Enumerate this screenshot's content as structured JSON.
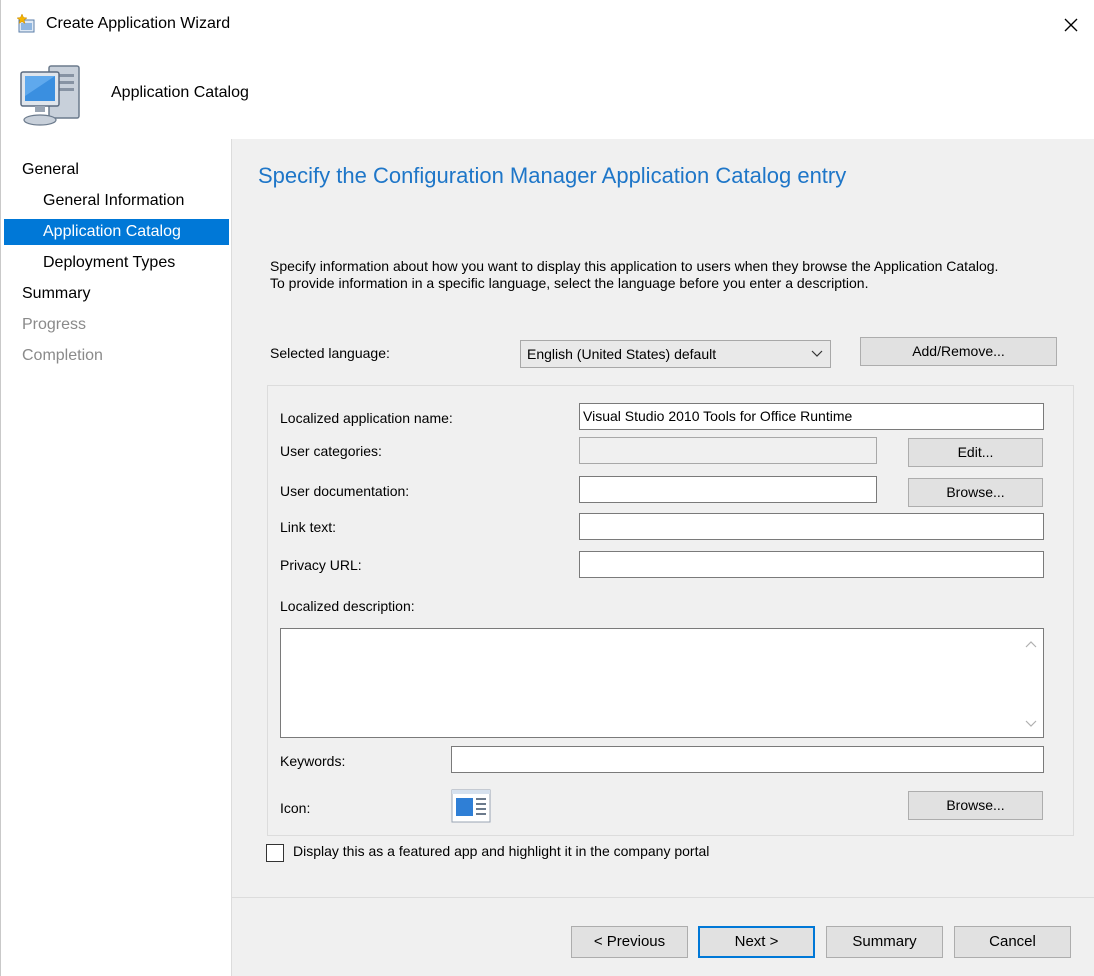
{
  "window": {
    "title": "Create Application Wizard",
    "header_title": "Application Catalog",
    "accent_color": "#0078d7",
    "heading_color": "#1e76c8"
  },
  "nav": {
    "items": [
      {
        "label": "General",
        "state": "normal",
        "level": "top"
      },
      {
        "label": "General Information",
        "state": "normal",
        "level": "sub"
      },
      {
        "label": "Application Catalog",
        "state": "selected",
        "level": "sub"
      },
      {
        "label": "Deployment Types",
        "state": "normal",
        "level": "sub"
      },
      {
        "label": "Summary",
        "state": "normal",
        "level": "top"
      },
      {
        "label": "Progress",
        "state": "disabled",
        "level": "top"
      },
      {
        "label": "Completion",
        "state": "disabled",
        "level": "top"
      }
    ]
  },
  "main": {
    "heading": "Specify the Configuration Manager Application Catalog entry",
    "intro_line1": "Specify information about how you want to display this application to users when they browse the Application Catalog.",
    "intro_line2": "To provide information in a specific language, select the language before you enter a description.",
    "language_label": "Selected language:",
    "language_value": "English (United States) default",
    "add_remove_label": "Add/Remove..."
  },
  "form": {
    "app_name_label": "Localized application name:",
    "app_name_value": "Visual Studio 2010 Tools for Office Runtime",
    "categories_label": "User categories:",
    "categories_value": "",
    "edit_label": "Edit...",
    "docs_label": "User documentation:",
    "docs_value": "",
    "browse_docs_label": "Browse...",
    "link_text_label": "Link text:",
    "link_text_value": "",
    "privacy_label": "Privacy URL:",
    "privacy_value": "",
    "description_label": "Localized description:",
    "keywords_label": "Keywords:",
    "keywords_value": "",
    "icon_label": "Icon:",
    "browse_icon_label": "Browse...",
    "featured_label": "Display this as a featured app and highlight it in the company portal",
    "featured_checked": false
  },
  "footer": {
    "previous_label": "< Previous",
    "next_label": "Next >",
    "summary_label": "Summary",
    "cancel_label": "Cancel"
  }
}
